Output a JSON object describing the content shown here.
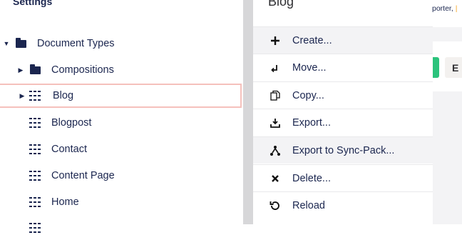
{
  "tree": {
    "section_title": "Settings",
    "items": [
      {
        "label": "Document Types",
        "icon": "folder-icon",
        "caret": "expanded"
      },
      {
        "label": "Compositions",
        "icon": "folder-icon",
        "caret": "collapsed"
      },
      {
        "label": "Blog",
        "icon": "doctype-icon",
        "caret": "collapsed",
        "selected": true
      },
      {
        "label": "Blogpost",
        "icon": "doctype-icon"
      },
      {
        "label": "Contact",
        "icon": "doctype-icon"
      },
      {
        "label": "Content Page",
        "icon": "doctype-icon"
      },
      {
        "label": "Home",
        "icon": "doctype-icon"
      }
    ]
  },
  "menu": {
    "title": "Blog",
    "items": [
      {
        "label": "Create...",
        "icon": "plus-icon"
      },
      {
        "label": "Move...",
        "icon": "move-icon"
      },
      {
        "label": "Copy...",
        "icon": "copy-icon"
      },
      {
        "label": "Export...",
        "icon": "export-icon"
      },
      {
        "label": "Export to Sync-Pack...",
        "icon": "sync-pack-icon"
      },
      {
        "label": "Delete...",
        "icon": "delete-icon"
      },
      {
        "label": "Reload",
        "icon": "reload-icon"
      }
    ]
  },
  "right": {
    "crumb_text": "porter,",
    "button_letter": "E"
  },
  "colors": {
    "text": "#1b264f",
    "selection_border": "#f5c1bc",
    "hover": "#f3f3f5",
    "green": "#2bc37c"
  }
}
